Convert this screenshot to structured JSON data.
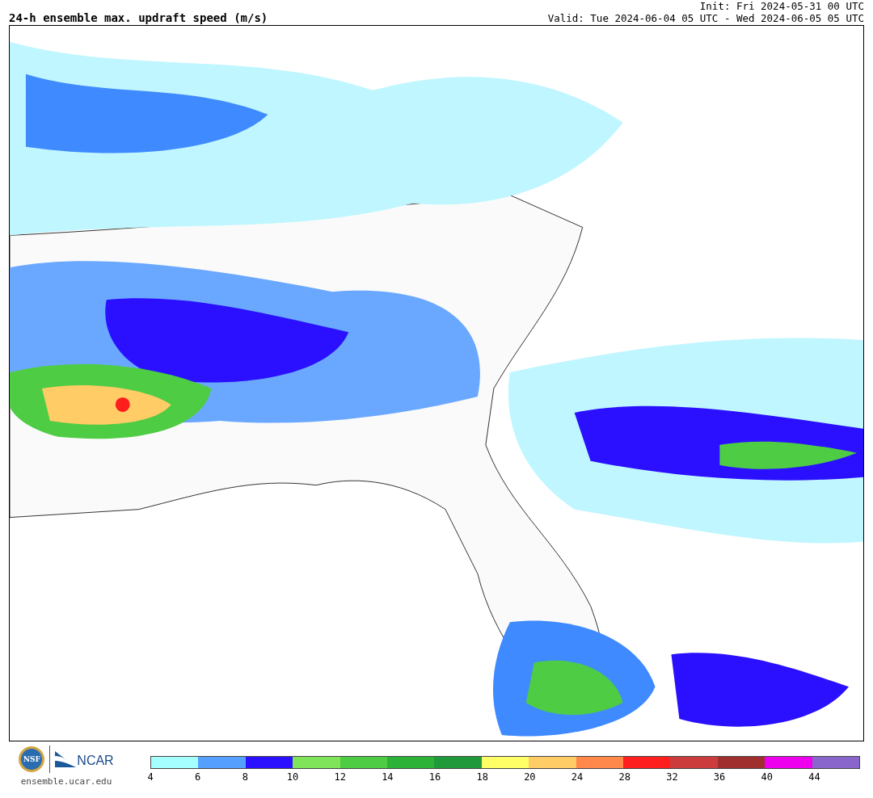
{
  "title": "24-h ensemble max. updraft speed (m/s)",
  "init": "Init: Fri 2024-05-31 00 UTC",
  "valid": "Valid: Tue 2024-06-04 05 UTC - Wed 2024-06-05 05 UTC",
  "logos": {
    "seal_text": "NSF",
    "ncar_text": "NCAR",
    "site": "ensemble.ucar.edu"
  },
  "colorbar": {
    "bins": [
      {
        "color": "#a6ffff",
        "label": "4"
      },
      {
        "color": "#55a0ff",
        "label": "6"
      },
      {
        "color": "#2a10ff",
        "label": "8"
      },
      {
        "color": "#80e45a",
        "label": "10"
      },
      {
        "color": "#4ecc44",
        "label": "12"
      },
      {
        "color": "#2db238",
        "label": "14"
      },
      {
        "color": "#20993a",
        "label": "16"
      },
      {
        "color": "#ffff66",
        "label": "18"
      },
      {
        "color": "#ffcc66",
        "label": "20"
      },
      {
        "color": "#ff884a",
        "label": "24"
      },
      {
        "color": "#ff1e1e",
        "label": "28"
      },
      {
        "color": "#cc3c3c",
        "label": "32"
      },
      {
        "color": "#a02e2e",
        "label": "36"
      },
      {
        "color": "#ee00ee",
        "label": "40"
      },
      {
        "color": "#8866cc",
        "label": "44"
      }
    ]
  }
}
